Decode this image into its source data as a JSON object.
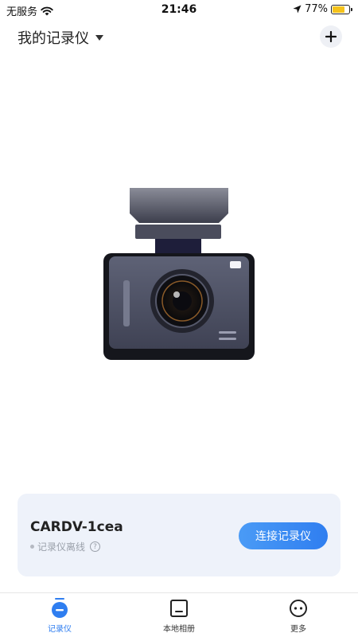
{
  "status_bar": {
    "carrier": "无服务",
    "time": "21:46",
    "battery_percent": "77%",
    "battery_level": 0.77
  },
  "header": {
    "title": "我的记录仪"
  },
  "device_card": {
    "name": "CARDV-1cea",
    "status": "记录仪离线",
    "connect_label": "连接记录仪"
  },
  "tabs": [
    {
      "label": "记录仪",
      "icon": "recorder-icon",
      "active": true
    },
    {
      "label": "本地相册",
      "icon": "album-icon",
      "active": false
    },
    {
      "label": "更多",
      "icon": "more-icon",
      "active": false
    }
  ],
  "colors": {
    "accent": "#2f7ef0",
    "battery": "#f5c21b",
    "card_bg": "#eef2fa"
  }
}
